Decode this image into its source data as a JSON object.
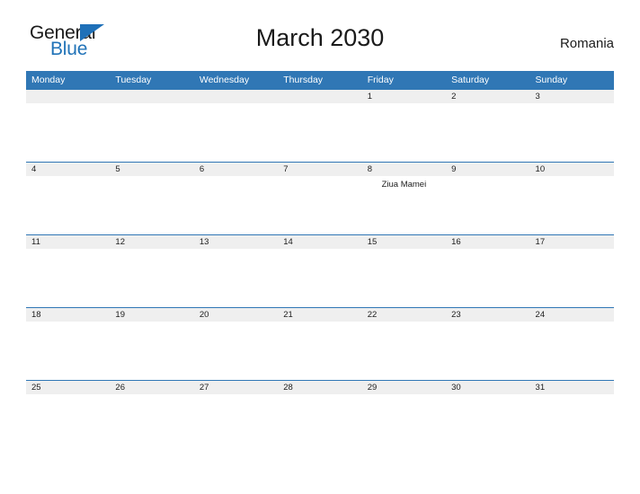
{
  "brand": {
    "word_one": "General",
    "word_two": "Blue",
    "triangle_icon": "triangle-right-icon",
    "color_primary": "#1e70b8",
    "color_text": "#1a1a1a"
  },
  "header": {
    "title": "March 2030",
    "country": "Romania"
  },
  "theme": {
    "header_blue": "#3077b5",
    "day_band_gray": "#efefef",
    "page_background": "#ffffff"
  },
  "calendar": {
    "weekday_headers": [
      "Monday",
      "Tuesday",
      "Wednesday",
      "Thursday",
      "Friday",
      "Saturday",
      "Sunday"
    ],
    "weeks": [
      [
        {
          "day": "",
          "events": []
        },
        {
          "day": "",
          "events": []
        },
        {
          "day": "",
          "events": []
        },
        {
          "day": "",
          "events": []
        },
        {
          "day": "1",
          "events": []
        },
        {
          "day": "2",
          "events": []
        },
        {
          "day": "3",
          "events": []
        }
      ],
      [
        {
          "day": "4",
          "events": []
        },
        {
          "day": "5",
          "events": []
        },
        {
          "day": "6",
          "events": []
        },
        {
          "day": "7",
          "events": []
        },
        {
          "day": "8",
          "events": [
            "Ziua Mamei"
          ]
        },
        {
          "day": "9",
          "events": []
        },
        {
          "day": "10",
          "events": []
        }
      ],
      [
        {
          "day": "11",
          "events": []
        },
        {
          "day": "12",
          "events": []
        },
        {
          "day": "13",
          "events": []
        },
        {
          "day": "14",
          "events": []
        },
        {
          "day": "15",
          "events": []
        },
        {
          "day": "16",
          "events": []
        },
        {
          "day": "17",
          "events": []
        }
      ],
      [
        {
          "day": "18",
          "events": []
        },
        {
          "day": "19",
          "events": []
        },
        {
          "day": "20",
          "events": []
        },
        {
          "day": "21",
          "events": []
        },
        {
          "day": "22",
          "events": []
        },
        {
          "day": "23",
          "events": []
        },
        {
          "day": "24",
          "events": []
        }
      ],
      [
        {
          "day": "25",
          "events": []
        },
        {
          "day": "26",
          "events": []
        },
        {
          "day": "27",
          "events": []
        },
        {
          "day": "28",
          "events": []
        },
        {
          "day": "29",
          "events": []
        },
        {
          "day": "30",
          "events": []
        },
        {
          "day": "31",
          "events": []
        }
      ]
    ]
  }
}
